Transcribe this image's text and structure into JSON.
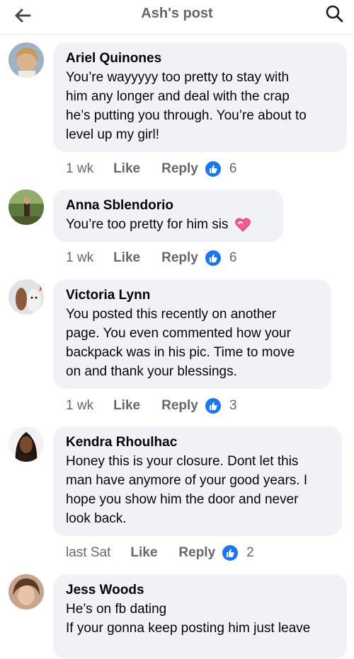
{
  "header": {
    "title": "Ash's post"
  },
  "comments": [
    {
      "author": "Ariel Quinones",
      "lines": [
        "You’re wayyyyy too pretty to stay with",
        "him any longer and deal with the crap",
        "he’s putting you through. You’re about to",
        "level up my girl!"
      ],
      "time": "1 wk",
      "like": "Like",
      "reply": "Reply",
      "reactions": "6"
    },
    {
      "author": "Anna Sblendorio",
      "lines": [
        "You’re too pretty for him sis"
      ],
      "emoji": "heart-emoji",
      "time": "1 wk",
      "like": "Like",
      "reply": "Reply",
      "reactions": "6"
    },
    {
      "author": "Victoria Lynn",
      "lines": [
        "You posted this recently on another",
        "page. You even commented how your",
        "backpack was in his pic. Time to move",
        "on and thank your blessings."
      ],
      "time": "1 wk",
      "like": "Like",
      "reply": "Reply",
      "reactions": "3"
    },
    {
      "author": "Kendra Rhoulhac",
      "lines": [
        "Honey this is your closure. Dont let this",
        "man have anymore of your good years. I",
        "hope you show him the door and never",
        "look back."
      ],
      "time": "last Sat",
      "like": "Like",
      "reply": "Reply",
      "reactions": "2"
    },
    {
      "author": "Jess Woods",
      "lines": [
        "He’s on fb dating",
        "If your gonna keep posting him just leave"
      ]
    }
  ],
  "icons": {
    "back": "arrow-left-icon",
    "search": "search-icon",
    "reaction": "thumbs-up-icon"
  },
  "colors": {
    "accent": "#1877f2",
    "bubble": "#f0f2f5",
    "muted": "#65676b"
  }
}
